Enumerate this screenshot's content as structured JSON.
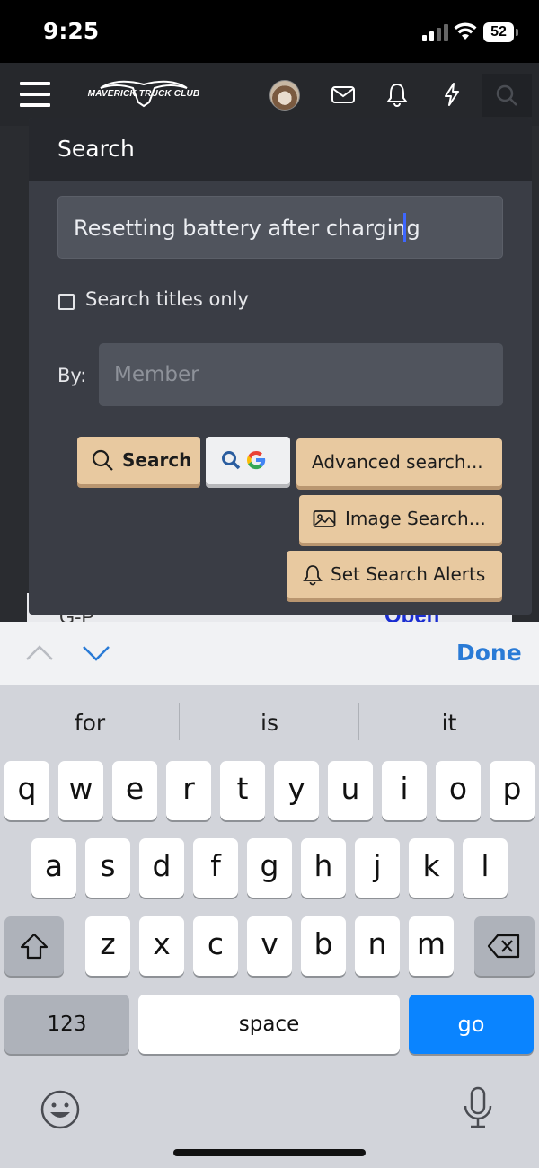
{
  "status_bar": {
    "time": "9:25",
    "battery": "52"
  },
  "site_header": {
    "logo_text": "MAVERICK TRUCK CLUB"
  },
  "search_popup": {
    "title": "Search",
    "query_value": "Resetting battery after charging",
    "titles_only_label": "Search titles only",
    "by_label": "By:",
    "member_placeholder": "Member",
    "buttons": {
      "search": "Search",
      "advanced": "Advanced search...",
      "image": "Image Search...",
      "alerts": "Set Search Alerts"
    }
  },
  "page_behind": {
    "row_label": "G-P",
    "row_action": "Open"
  },
  "accessory_bar": {
    "done_label": "Done"
  },
  "keyboard": {
    "suggestions": [
      "for",
      "is",
      "it"
    ],
    "row1": [
      "q",
      "w",
      "e",
      "r",
      "t",
      "y",
      "u",
      "i",
      "o",
      "p"
    ],
    "row2": [
      "a",
      "s",
      "d",
      "f",
      "g",
      "h",
      "j",
      "k",
      "l"
    ],
    "row3": [
      "z",
      "x",
      "c",
      "v",
      "b",
      "n",
      "m"
    ],
    "numbers_key": "123",
    "space_key": "space",
    "go_key": "go"
  },
  "colors": {
    "accent_button": "#e8c9a0",
    "go_key": "#0a84ff",
    "done_link": "#2a7bd6",
    "popup_bg": "#3a3d45"
  },
  "icons": [
    "menu-icon",
    "mail-icon",
    "bell-icon",
    "bolt-icon",
    "search-icon",
    "google-icon",
    "image-icon",
    "shift-icon",
    "delete-icon",
    "emoji-icon",
    "microphone-icon"
  ]
}
